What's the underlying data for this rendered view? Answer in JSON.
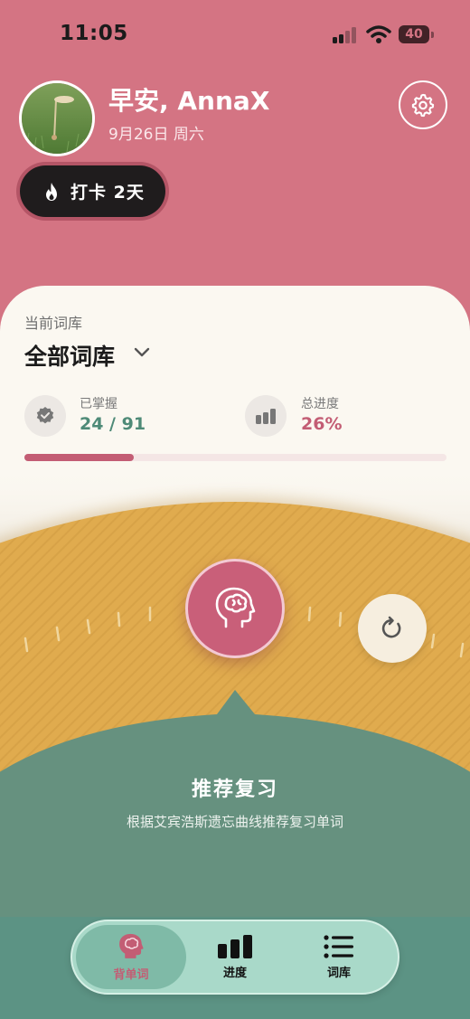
{
  "status_bar": {
    "time": "11:05",
    "battery": "40"
  },
  "header": {
    "greeting": "早安, AnnaX",
    "date": "9月26日 周六",
    "streak_label": "打卡 2天"
  },
  "library": {
    "label": "当前词库",
    "name": "全部词库",
    "mastered_label": "已掌握",
    "mastered_value": "24 / 91",
    "progress_label": "总进度",
    "progress_value": "26%",
    "progress_fraction": 0.26
  },
  "recommend": {
    "title": "推荐复习",
    "description": "根据艾宾浩斯遗忘曲线推荐复习单词"
  },
  "tabs": [
    {
      "label": "背单词",
      "icon": "brain-icon",
      "active": true
    },
    {
      "label": "进度",
      "icon": "bar-chart-icon",
      "active": false
    },
    {
      "label": "词库",
      "icon": "list-icon",
      "active": false
    }
  ],
  "colors": {
    "header_bg": "#d47483",
    "card_bg": "#fbf8f1",
    "accent_pink": "#c95f79",
    "mastered_green": "#4e8a77",
    "gold": "#e0ab4e",
    "teal": "#66917f",
    "tabbar": "#a9d9c9"
  }
}
